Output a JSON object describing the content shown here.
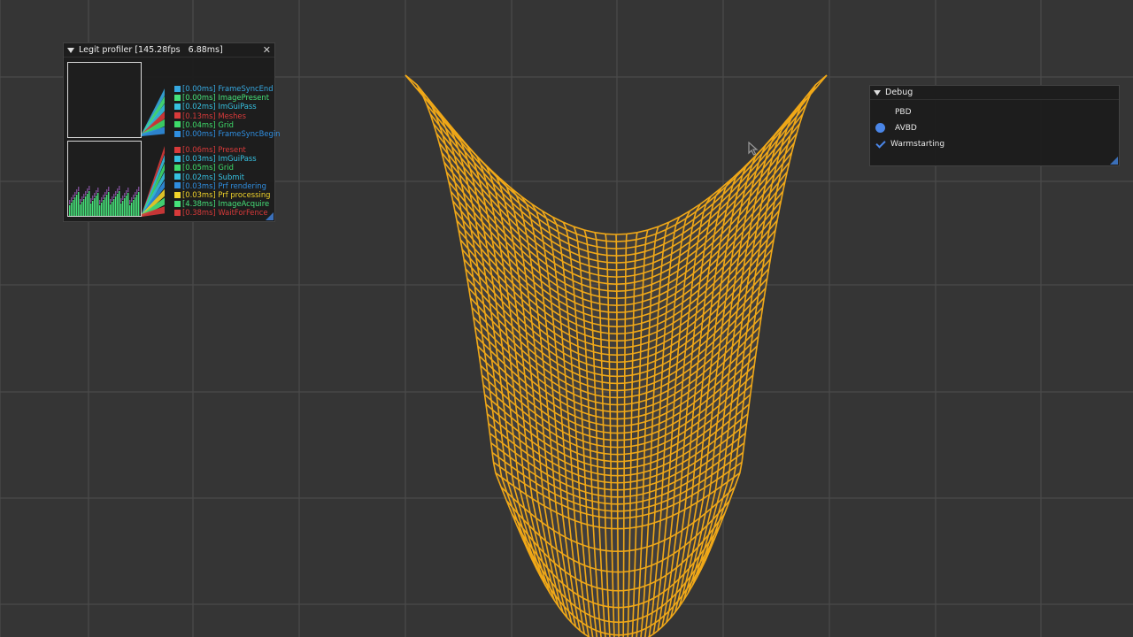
{
  "profiler": {
    "title": "Legit profiler [145.28fps   6.88ms]",
    "top_entries": [
      {
        "label": "[0.00ms] FrameSyncEnd",
        "color": "#36a8e0"
      },
      {
        "label": "[0.00ms] ImagePresent",
        "color": "#46e27a"
      },
      {
        "label": "[0.02ms] ImGuiPass",
        "color": "#36c0e0"
      },
      {
        "label": "[0.13ms] Meshes",
        "color": "#d83a3a"
      },
      {
        "label": "[0.04ms] Grid",
        "color": "#3edc6a"
      },
      {
        "label": "[0.00ms] FrameSyncBegin",
        "color": "#2f8ee0"
      }
    ],
    "bottom_entries": [
      {
        "label": "[0.06ms] Present",
        "color": "#d83a3a"
      },
      {
        "label": "[0.03ms] ImGuiPass",
        "color": "#36c0e0"
      },
      {
        "label": "[0.05ms] Grid",
        "color": "#3edc6a"
      },
      {
        "label": "[0.02ms] Submit",
        "color": "#36c0e0"
      },
      {
        "label": "[0.03ms] Prf rendering",
        "color": "#2f8ee0"
      },
      {
        "label": "[0.03ms] Prf processing",
        "color": "#f2d42a"
      },
      {
        "label": "[4.38ms] ImageAcquire",
        "color": "#46e27a"
      },
      {
        "label": "[0.38ms] WaitForFence",
        "color": "#d83a3a"
      }
    ]
  },
  "debug": {
    "title": "Debug",
    "options": [
      {
        "label": "PBD",
        "type": "radio",
        "selected": false
      },
      {
        "label": "AVBD",
        "type": "radio",
        "selected": true
      },
      {
        "label": "Warmstarting",
        "type": "checkbox",
        "checked": true
      }
    ]
  },
  "colors": {
    "background": "#353535",
    "grid": "#4a4a4a",
    "cloth": "#f0a818",
    "accent": "#4a86e8"
  },
  "icons": {
    "collapse": "triangle-down-icon",
    "close": "close-icon",
    "cursor": "mouse-cursor-icon"
  }
}
